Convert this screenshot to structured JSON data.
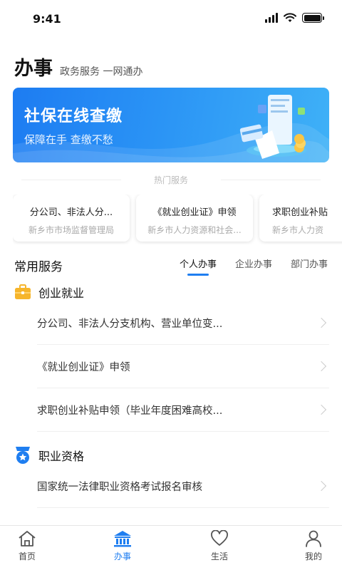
{
  "status": {
    "time": "9:41"
  },
  "header": {
    "title": "办事",
    "subtitle": "政务服务 一网通办"
  },
  "banner": {
    "title": "社保在线查缴",
    "subtitle": "保障在手  查缴不愁"
  },
  "hot": {
    "title": "热门服务",
    "cards": [
      {
        "title": "分公司、非法人分...",
        "org": "新乡市市场监督管理局"
      },
      {
        "title": "《就业创业证》申领",
        "org": "新乡市人力资源和社会..."
      },
      {
        "title": "求职创业补贴",
        "org": "新乡市人力资"
      }
    ]
  },
  "common": {
    "title": "常用服务",
    "tabs": [
      "个人办事",
      "企业办事",
      "部门办事"
    ],
    "active_tab": "个人办事",
    "categories": [
      {
        "name": "创业就业",
        "icon": "briefcase-icon",
        "items": [
          "分公司、非法人分支机构、营业单位变...",
          "《就业创业证》申领",
          "求职创业补贴申领（毕业年度困难高校..."
        ]
      },
      {
        "name": "职业资格",
        "icon": "medal-icon",
        "items": [
          "国家统一法律职业资格考试报名审核"
        ]
      }
    ]
  },
  "tabbar": {
    "items": [
      {
        "label": "首页",
        "icon": "home-icon"
      },
      {
        "label": "办事",
        "icon": "government-building-icon"
      },
      {
        "label": "生活",
        "icon": "heart-icon"
      },
      {
        "label": "我的",
        "icon": "person-icon"
      }
    ],
    "active": "办事"
  },
  "colors": {
    "accent": "#1f7ef0",
    "banner_start": "#1d7cf2",
    "banner_end": "#3fb1f7",
    "briefcase": "#f6b52b"
  }
}
